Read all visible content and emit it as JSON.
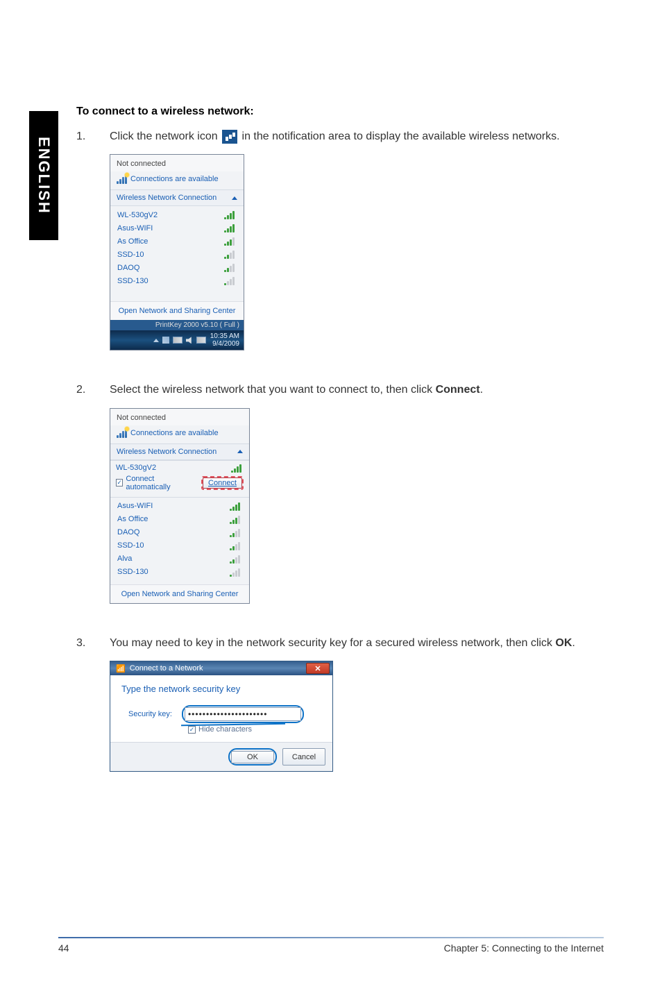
{
  "side_tab": "ENGLISH",
  "heading": "To connect to a wireless network:",
  "steps": {
    "s1": {
      "num": "1.",
      "text_a": "Click the network icon ",
      "text_b": " in the notification area to display the available wireless networks."
    },
    "s2": {
      "num": "2.",
      "text_a": "Select the wireless network that you want to connect to, then click ",
      "bold": "Connect",
      "text_b": "."
    },
    "s3": {
      "num": "3.",
      "text_a": "You may need to key in the network security key for a secured wireless network, then click ",
      "bold": "OK",
      "text_b": "."
    }
  },
  "panel1": {
    "status": "Not connected",
    "subtext": "Connections are available",
    "section": "Wireless Network Connection",
    "items": [
      {
        "name": "WL-530gV2",
        "strength": 4
      },
      {
        "name": "Asus-WIFI",
        "strength": 4
      },
      {
        "name": "As Office",
        "strength": 3
      },
      {
        "name": "SSD-10",
        "strength": 2
      },
      {
        "name": "DAOQ",
        "strength": 2
      },
      {
        "name": "SSD-130",
        "strength": 1
      }
    ],
    "footer": "Open Network and Sharing Center",
    "printkey": "PrintKey 2000  v5.10 ( Full )",
    "clock": {
      "time": "10:35 AM",
      "date": "9/4/2009"
    }
  },
  "panel2": {
    "status": "Not connected",
    "subtext": "Connections are available",
    "section": "Wireless Network Connection",
    "selected": {
      "name": "WL-530gV2",
      "auto_label": "Connect automatically",
      "connect": "Connect"
    },
    "items": [
      {
        "name": "Asus-WIFI",
        "strength": 4
      },
      {
        "name": "As Office",
        "strength": 3
      },
      {
        "name": "DAOQ",
        "strength": 2
      },
      {
        "name": "SSD-10",
        "strength": 2
      },
      {
        "name": "Alva",
        "strength": 2
      },
      {
        "name": "SSD-130",
        "strength": 1
      }
    ],
    "footer": "Open Network and Sharing Center"
  },
  "dialog": {
    "title": "Connect to a Network",
    "heading": "Type the network security key",
    "label": "Security key:",
    "value": "••••••••••••••••••••••",
    "hide": "Hide characters",
    "ok": "OK",
    "cancel": "Cancel"
  },
  "footer": {
    "page": "44",
    "chapter": "Chapter 5: Connecting to the Internet"
  }
}
